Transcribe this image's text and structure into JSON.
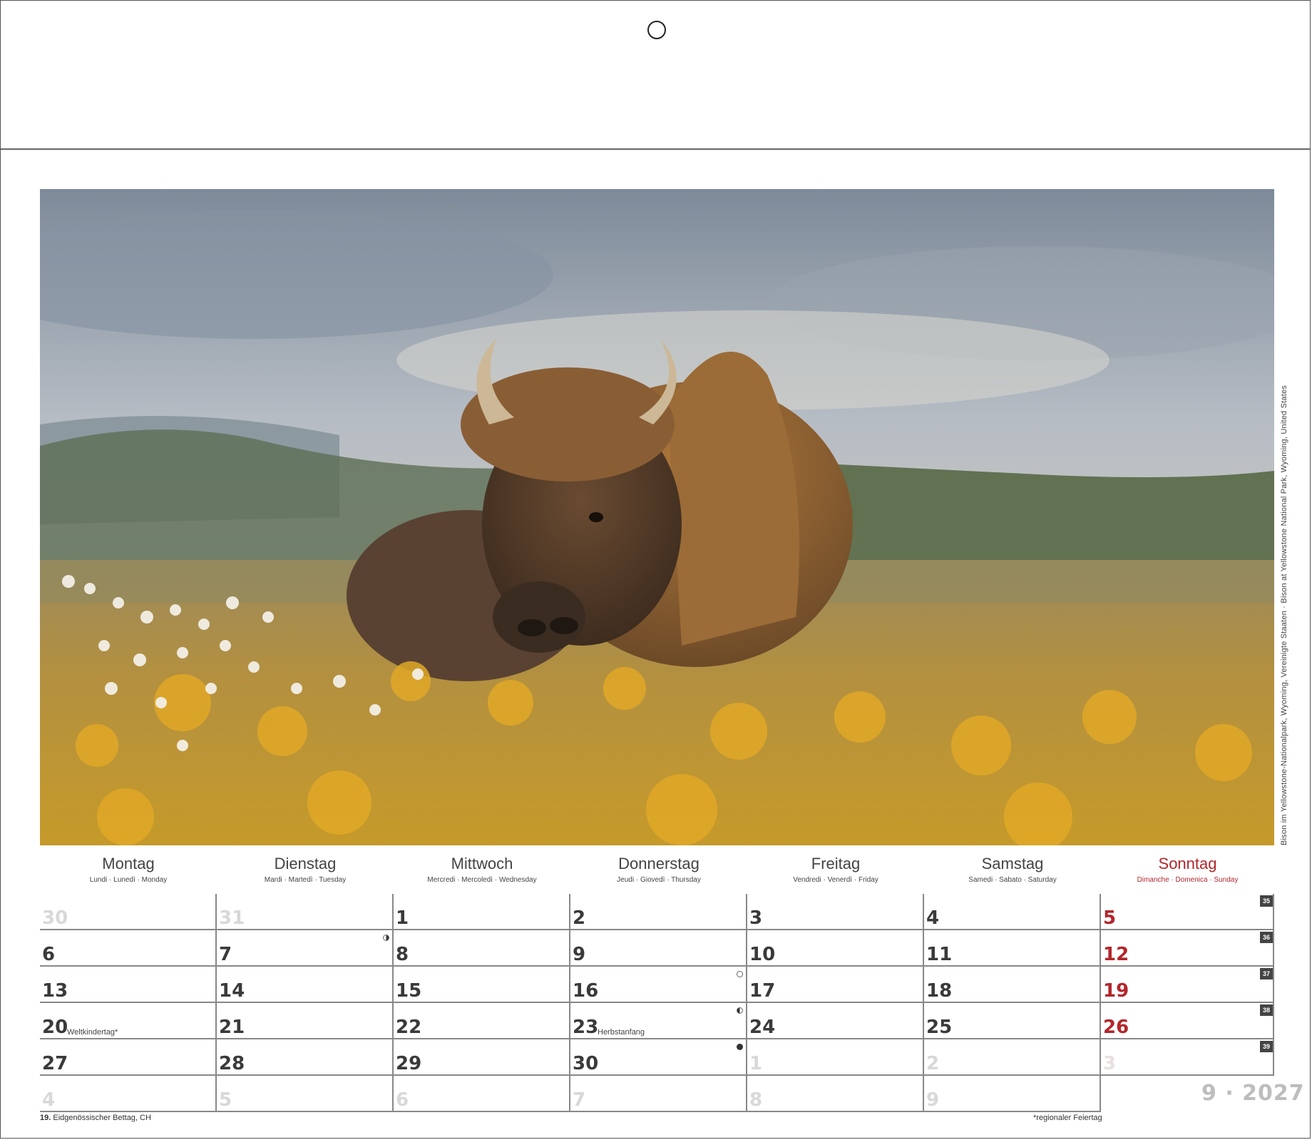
{
  "photo": {
    "caption": "Bison im Yellowstone-Nationalpark, Wyoming, Vereinigte Staaten · Bison at Yellowstone National Park, Wyoming, United States"
  },
  "weekdays": [
    {
      "name": "Montag",
      "sub": "Lundi · Lunedì · Monday"
    },
    {
      "name": "Dienstag",
      "sub": "Mardi · Martedì · Tuesday"
    },
    {
      "name": "Mittwoch",
      "sub": "Mercredi · Mercoledì · Wednesday"
    },
    {
      "name": "Donnerstag",
      "sub": "Jeudi · Giovedì · Thursday"
    },
    {
      "name": "Freitag",
      "sub": "Vendredi · Venerdì · Friday"
    },
    {
      "name": "Samstag",
      "sub": "Samedi · Sabato · Saturday"
    },
    {
      "name": "Sonntag",
      "sub": "Dimanche · Domenica · Sunday"
    }
  ],
  "weeks": [
    {
      "week": "35",
      "days": [
        "30",
        "31",
        "1",
        "2",
        "3",
        "4",
        "5"
      ]
    },
    {
      "week": "36",
      "days": [
        "6",
        "7",
        "8",
        "9",
        "10",
        "11",
        "12"
      ]
    },
    {
      "week": "37",
      "days": [
        "13",
        "14",
        "15",
        "16",
        "17",
        "18",
        "19"
      ]
    },
    {
      "week": "38",
      "days": [
        "20",
        "21",
        "22",
        "23",
        "24",
        "25",
        "26"
      ]
    },
    {
      "week": "39",
      "days": [
        "27",
        "28",
        "29",
        "30",
        "1",
        "2",
        "3"
      ]
    },
    {
      "week": "",
      "days": [
        "4",
        "5",
        "6",
        "7",
        "8",
        "9",
        ""
      ]
    }
  ],
  "notes": {
    "weltkindertag": "Weltkindertag*",
    "herbstanfang": "Herbstanfang"
  },
  "footer": {
    "holiday_day": "19.",
    "holiday_name": "Eidgenössischer Bettag, CH",
    "regional_note": "*regionaler Feiertag"
  },
  "month_year": "9 · 2027",
  "colors": {
    "sunday_red": "#b3262b",
    "week_badge": "#444444"
  }
}
